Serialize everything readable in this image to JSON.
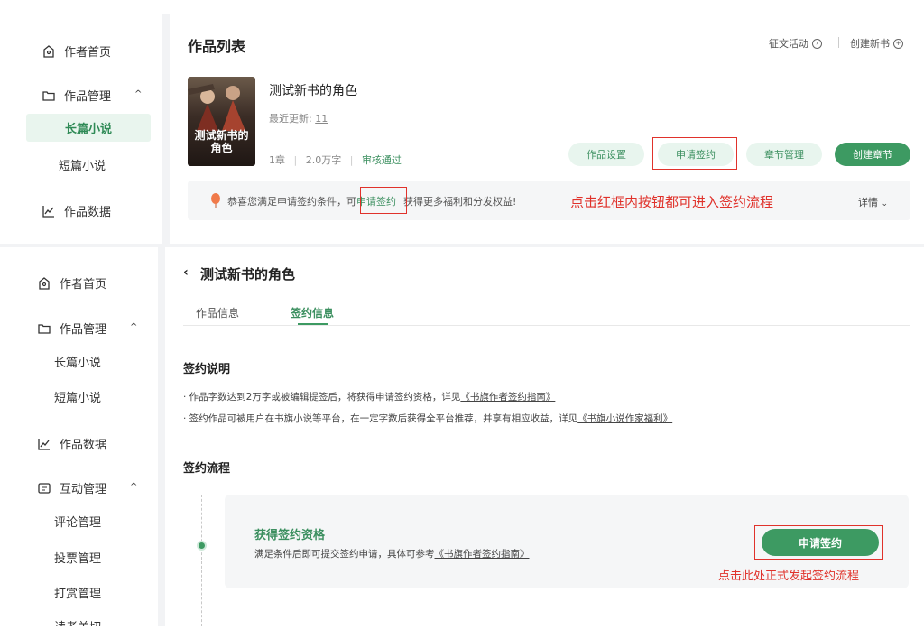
{
  "top_sidebar": {
    "home": "作者首页",
    "works": "作品管理",
    "long_novel": "长篇小说",
    "short_novel": "短篇小说",
    "data": "作品数据"
  },
  "top_main": {
    "title": "作品列表",
    "contest": "征文活动",
    "new_book": "创建新书",
    "book": {
      "name": "测试新书的角色",
      "updated_label": "最近更新:",
      "updated_value": "11",
      "chapters": "1章",
      "words": "2.0万字",
      "status": "审核通过",
      "cover_title": "测试新书的角色"
    },
    "buttons": {
      "settings": "作品设置",
      "apply": "申请签约",
      "chapters": "章节管理",
      "create": "创建章节"
    },
    "notice": {
      "prefix": "恭喜您满足申请签约条件，可",
      "link": "申请签约",
      "suffix": "获得更多福利和分发权益!",
      "details": "详情"
    },
    "annotation": "点击红框内按钮都可进入签约流程"
  },
  "bottom_sidebar": {
    "home": "作者首页",
    "works": "作品管理",
    "long_novel": "长篇小说",
    "short_novel": "短篇小说",
    "data": "作品数据",
    "interact": "互动管理",
    "comments": "评论管理",
    "votes": "投票管理",
    "tips": "打赏管理",
    "more": "读者关切"
  },
  "bottom_main": {
    "back_title": "测试新书的角色",
    "tabs": [
      "作品信息",
      "签约信息"
    ],
    "explain_title": "签约说明",
    "bullet1_prefix": "· 作品字数达到2万字或被编辑提签后，将获得申请签约资格，详见",
    "bullet1_link": "《书旗作者签约指南》",
    "bullet2_prefix": "· 签约作品可被用户在书旗小说等平台，在一定字数后获得全平台推荐，并享有相应收益，详见",
    "bullet2_link": "《书旗小说作家福利》",
    "process_title": "签约流程",
    "step_title": "获得签约资格",
    "step_desc_prefix": "满足条件后即可提交签约申请，具体可参考",
    "step_desc_link": "《书旗作者签约指南》",
    "apply_button": "申请签约",
    "annotation": "点击此处正式发起签约流程"
  },
  "colors": {
    "accent": "#3d9a62",
    "accent_light": "#e8f5ee",
    "annotation_red": "#e0322b"
  }
}
